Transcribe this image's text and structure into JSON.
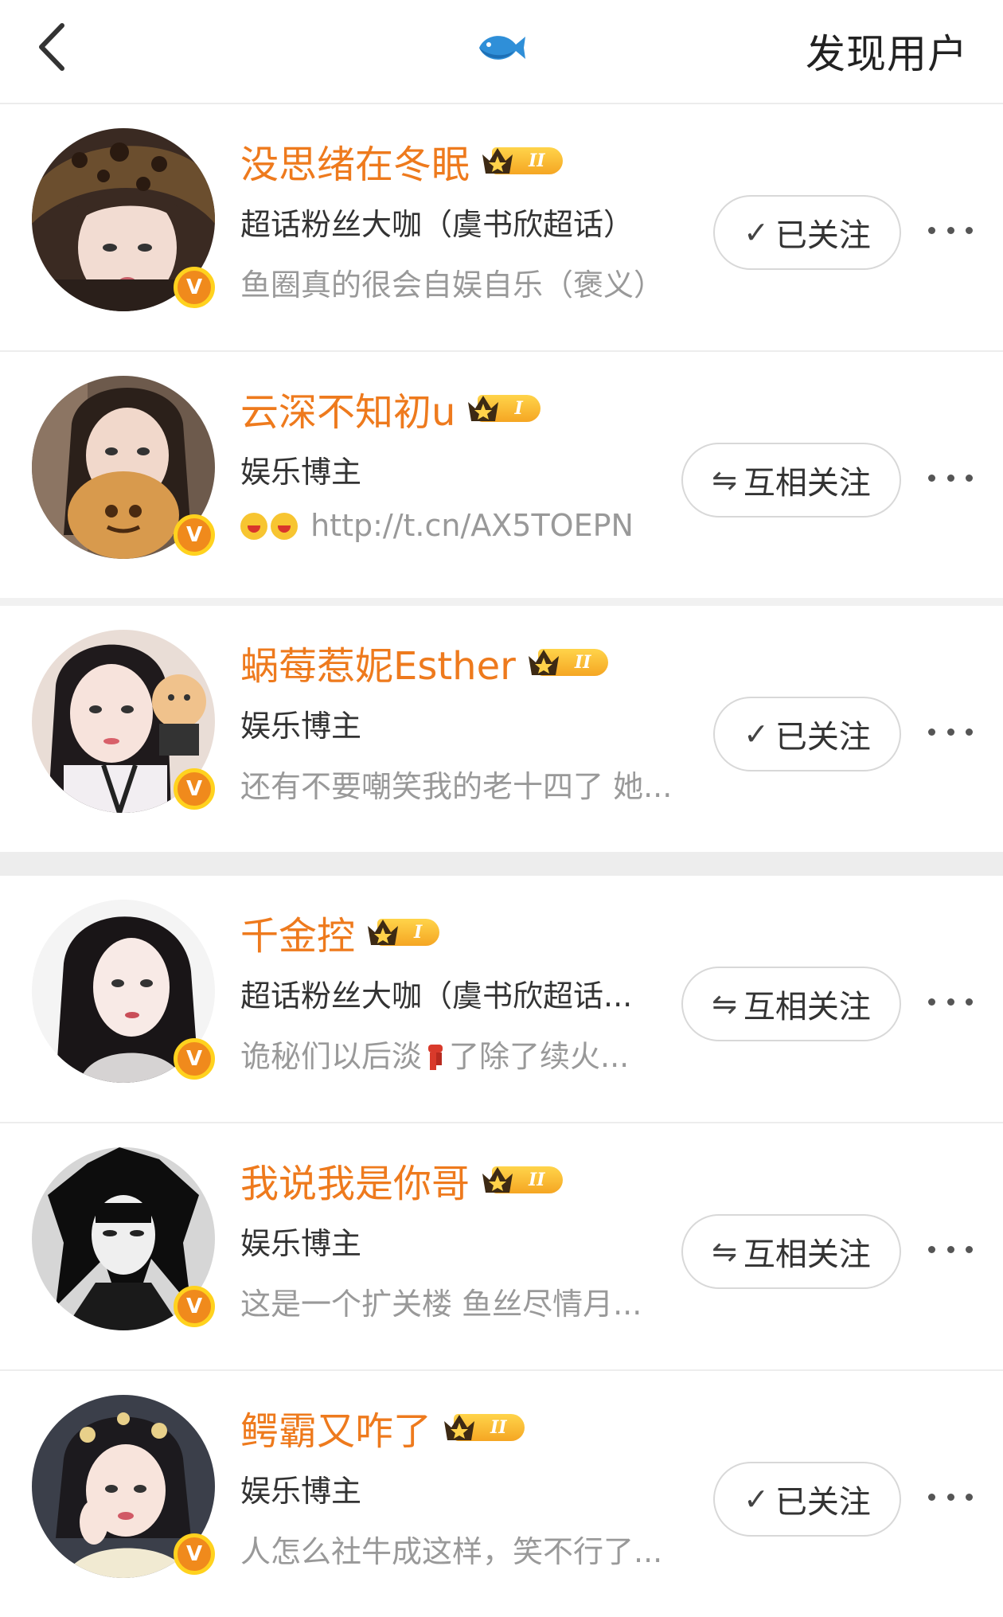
{
  "header": {
    "title": "发现用户"
  },
  "users": [
    {
      "name": "没思绪在冬眠",
      "level": "II",
      "desc": "超话粉丝大咖（虞书欣超话）",
      "intro": "鱼圈真的很会自娱自乐（褒义）",
      "follow": "已关注",
      "follow_icon": "check-icon"
    },
    {
      "name": "云深不知初u",
      "level": "I",
      "desc": "娱乐博主",
      "intro": "http://t.cn/AX5TOEPN",
      "follow": "互相关注",
      "follow_icon": "mutual-arrows-icon"
    },
    {
      "name": "蜗莓惹妮Esther",
      "level": "II",
      "desc": "娱乐博主",
      "intro": "还有不要嘲笑我的老十四了 她...",
      "follow": "已关注",
      "follow_icon": "check-icon"
    },
    {
      "name": "千金控",
      "level": "I",
      "desc": "超话粉丝大咖（虞书欣超话...",
      "intro_a": "诡秘们以后淡",
      "intro_b": "了除了续火...",
      "follow": "互相关注",
      "follow_icon": "mutual-arrows-icon"
    },
    {
      "name": "我说我是你哥",
      "level": "II",
      "desc": "娱乐博主",
      "intro": "这是一个扩关楼 鱼丝尽情月...",
      "follow": "互相关注",
      "follow_icon": "mutual-arrows-icon"
    },
    {
      "name": "鳄霸又咋了",
      "level": "II",
      "desc": "娱乐博主",
      "intro": "人怎么社牛成这样，笑不行了...",
      "follow": "已关注",
      "follow_icon": "check-icon"
    }
  ],
  "icons": {
    "back": "back-arrow-icon",
    "logo": "fish-logo-icon",
    "more": "more-dots-icon",
    "verified": "verified-v-badge-icon",
    "crown": "crown-level-icon"
  },
  "colors": {
    "name": "#ee7a1d",
    "badge": "#f08a1c",
    "badge_ring": "#ffd21e",
    "level_pill": "#f5a623"
  }
}
